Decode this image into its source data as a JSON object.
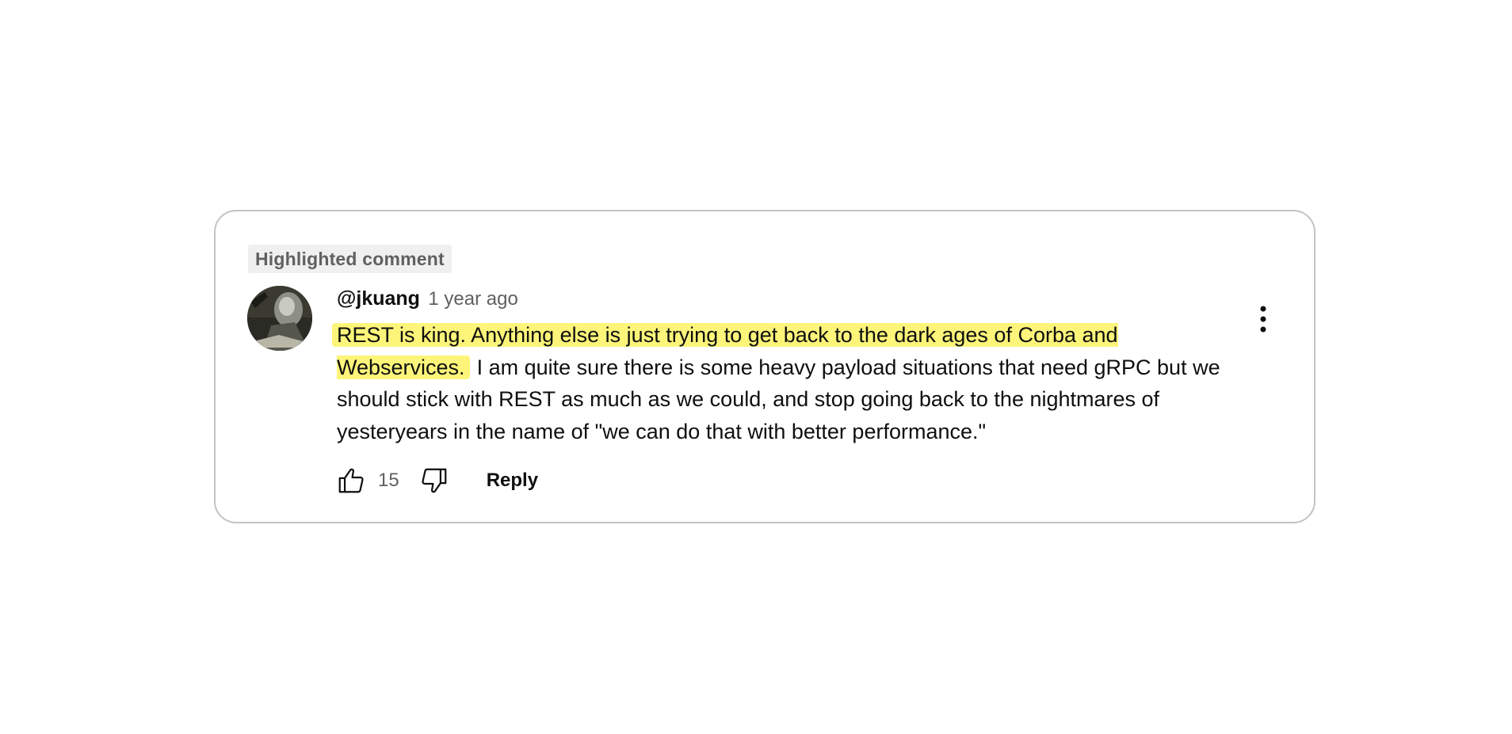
{
  "badge": {
    "label": "Highlighted comment"
  },
  "comment": {
    "author": "@jkuang",
    "time": "1 year ago",
    "text_highlighted": "REST is king.  Anything else is just trying to get back to the dark ages of Corba  and Webservices.",
    "text_rest": "  I am quite sure there is some heavy payload situations that need gRPC but we should stick with REST as much as we could, and stop going back to the nightmares of yesteryears in the name of \"we can do that with better performance.\"",
    "highlight_color": "#fdf57a"
  },
  "actions": {
    "like_icon": "thumbs-up-icon",
    "like_count": "15",
    "dislike_icon": "thumbs-down-icon",
    "reply_label": "Reply",
    "menu_icon": "more-vert-icon"
  },
  "avatar": {
    "icon": "avatar-image"
  }
}
